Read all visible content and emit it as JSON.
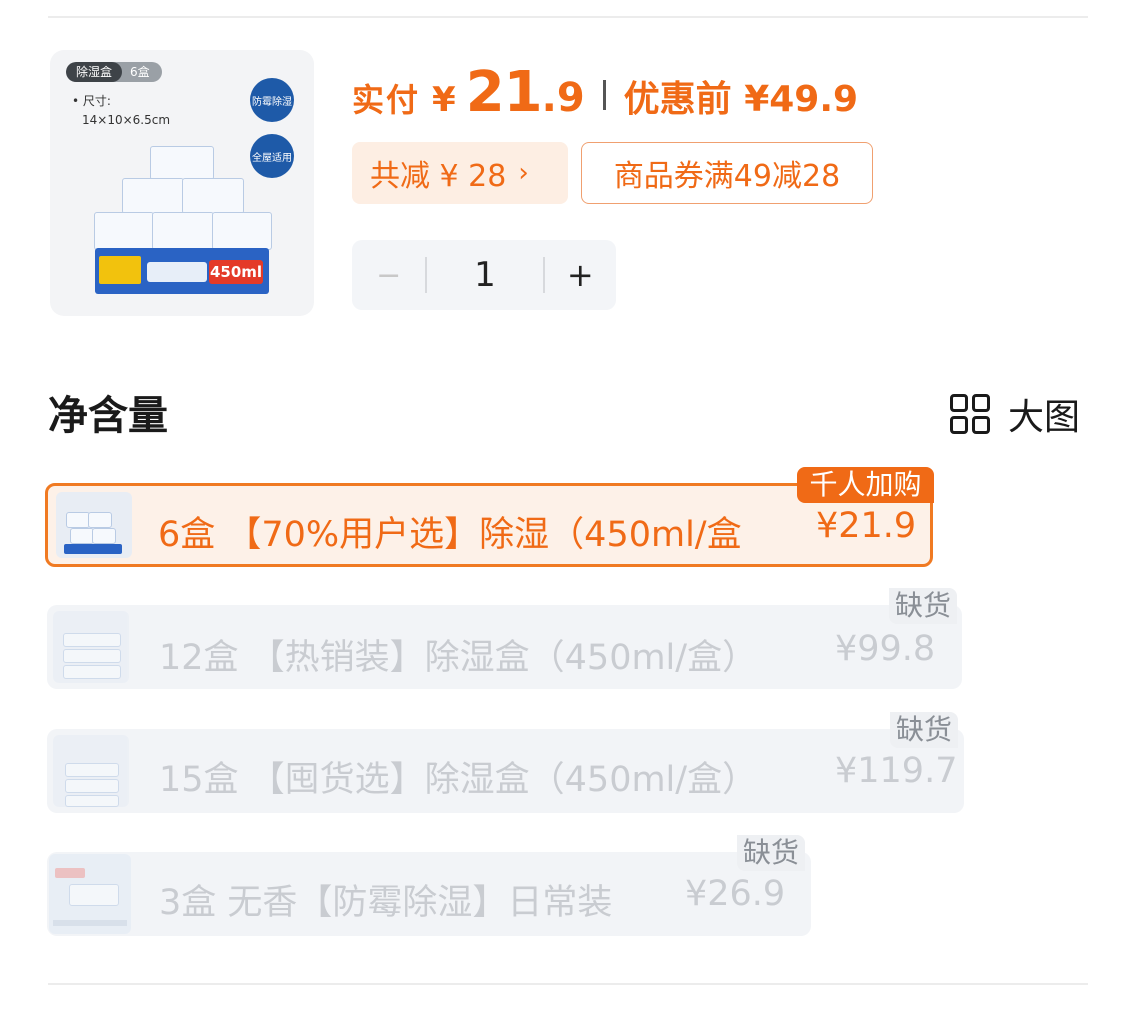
{
  "product": {
    "thumb_tag_a": "除湿盒",
    "thumb_tag_b": "6盒",
    "thumb_size_label": "• 尺寸:",
    "thumb_size_value": "14×10×6.5cm",
    "thumb_badge_1": "防霉除湿",
    "thumb_badge_2": "全屋适用",
    "thumb_volume": "450ml"
  },
  "price": {
    "pay_label": "实付",
    "currency": "¥",
    "pay_integer": "21",
    "pay_decimal": ".9",
    "original_label": "优惠前 ¥49.9",
    "discount_label": "共减 ¥ 28",
    "discount_chevron": "›",
    "coupon_label": "商品券满49减28"
  },
  "quantity": {
    "minus": "−",
    "value": "1",
    "plus": "+"
  },
  "section": {
    "title": "净含量",
    "view_label": "大图",
    "view_icon": "grid-icon"
  },
  "options": [
    {
      "text": "6盒  【70%用户选】除湿（450ml/盒",
      "price": "¥21.9",
      "badge": "千人加购",
      "state": "selected"
    },
    {
      "text": "12盒 【热销装】除湿盒（450ml/盒）",
      "price": "¥99.8",
      "badge": "缺货",
      "state": "out-of-stock"
    },
    {
      "text": "15盒 【囤货选】除湿盒（450ml/盒）",
      "price": "¥119.7",
      "badge": "缺货",
      "state": "out-of-stock"
    },
    {
      "text": "3盒 无香【防霉除湿】日常装",
      "price": "¥26.9",
      "badge": "缺货",
      "state": "out-of-stock"
    }
  ],
  "colors": {
    "accent": "#f06a16",
    "selected_bg": "#fdf1e8",
    "disabled_bg": "#f2f4f7",
    "disabled_text": "#c9ccd1"
  }
}
